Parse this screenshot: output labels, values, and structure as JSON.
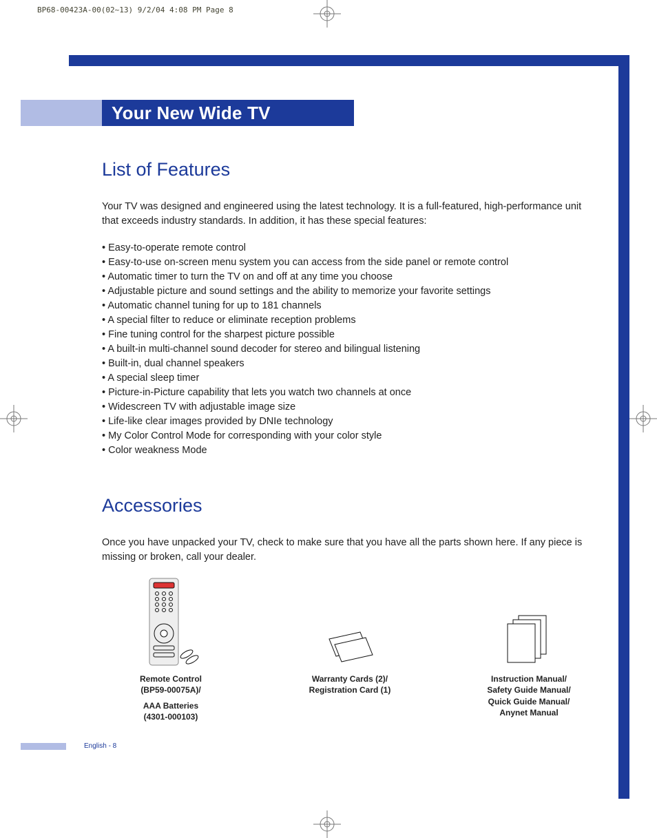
{
  "print_header": "BP68-00423A-00(02~13)  9/2/04  4:08 PM  Page 8",
  "page_title": "Your New Wide TV",
  "section1_title": "List of Features",
  "intro_para": "Your TV was designed and engineered using the latest technology. It is a full-featured, high-performance unit that exceeds industry standards. In addition, it has these special features:",
  "features": [
    "Easy-to-operate remote control",
    "Easy-to-use on-screen menu system you can access from the side panel or remote control",
    "Automatic timer to turn the TV on and off at any time you choose",
    "Adjustable picture and sound settings and the ability to memorize your favorite settings",
    "Automatic channel tuning for up to 181 channels",
    "A special filter to reduce or eliminate reception problems",
    "Fine tuning control for the sharpest picture possible",
    "A built-in multi-channel sound decoder for stereo and bilingual listening",
    "Built-in, dual channel speakers",
    "A special sleep timer",
    "Picture-in-Picture capability that lets you watch two channels at once",
    "Widescreen TV with adjustable image size",
    "Life-like clear images provided by DNIe technology",
    "My Color Control Mode for corresponding with your color style",
    "Color weakness Mode"
  ],
  "section2_title": "Accessories",
  "acc_para": "Once you have unpacked your TV, check to make sure that you have all the parts shown here. If any piece is missing or broken, call your dealer.",
  "acc1_l1": "Remote Control",
  "acc1_l2": "(BP59-00075A)/",
  "acc1_l3": "AAA Batteries",
  "acc1_l4": "(4301-000103)",
  "acc2_l1": "Warranty Cards (2)/",
  "acc2_l2": "Registration Card (1)",
  "acc3_l1": "Instruction Manual/",
  "acc3_l2": "Safety Guide Manual/",
  "acc3_l3": "Quick Guide Manual/",
  "acc3_l4": "Anynet Manual",
  "footer": "English - 8"
}
